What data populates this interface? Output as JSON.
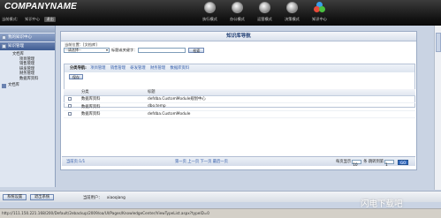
{
  "app": {
    "logo_text": "COMPANYNAME",
    "sub_items": [
      "当前模式：",
      "知识中心",
      "退出"
    ]
  },
  "modules": [
    {
      "label": "执行模式",
      "icon": "gear-sphere-icon"
    },
    {
      "label": "办公模式",
      "icon": "globe-sphere-icon"
    },
    {
      "label": "运营模式",
      "icon": "chart-sphere-icon"
    },
    {
      "label": "决策模式",
      "icon": "decision-sphere-icon"
    },
    {
      "label": "知识中心",
      "icon": "knowledge-cluster-icon"
    }
  ],
  "sidebar": {
    "sections": [
      {
        "label": "我的知识中心"
      },
      {
        "label": "知识管理"
      }
    ],
    "tree": [
      {
        "label": "文档库",
        "level": 2
      },
      {
        "label": "项目管理",
        "level": 3
      },
      {
        "label": "销售管理",
        "level": 3
      },
      {
        "label": "研发管理",
        "level": 3
      },
      {
        "label": "财务管理",
        "level": 3
      },
      {
        "label": "数据库资料",
        "level": 3
      }
    ],
    "last": "文档库"
  },
  "main": {
    "title": "知识库导航",
    "path": "当前位置：[文档库]",
    "filter": {
      "select_value": "--请选择--",
      "label": "标题或关键字：",
      "input_value": "",
      "button": "检索"
    },
    "nav": {
      "label": "分类导航:",
      "links": [
        "项目管理",
        "销售管理",
        "研发管理",
        "财务管理",
        "数据库资料"
      ],
      "save_button": "保存"
    },
    "table": {
      "headers": [
        "",
        "分类",
        "标题"
      ],
      "rows": [
        {
          "category": "数据库资料",
          "title": "defdba.CustomModule规划中心"
        },
        {
          "category": "数据库资料",
          "title": "dbo.temp"
        },
        {
          "category": "数据库资料",
          "title": "defdba.CustomModule"
        }
      ]
    },
    "pager": {
      "info": "当前页:1/1",
      "links": "第一页  上一页  下一页  最后一页",
      "page_size_label": "每页显示",
      "page_size_value": "10",
      "goto_label": "条 跳转到第",
      "goto_value": "1",
      "goto_button": "GO"
    }
  },
  "bottom": {
    "buttons": [
      "系统设置",
      "退出系统"
    ],
    "user_label": "当前用户：",
    "user_name": "xiaoqiang"
  },
  "statusbar": {
    "url": "http://111.150.221.168/200/Default/2ebackup/2009/oa/UI/Pages/KnowledgeCenter/ViewTypeList.aspx?typeID=0"
  },
  "watermark": "闪电下载吧"
}
